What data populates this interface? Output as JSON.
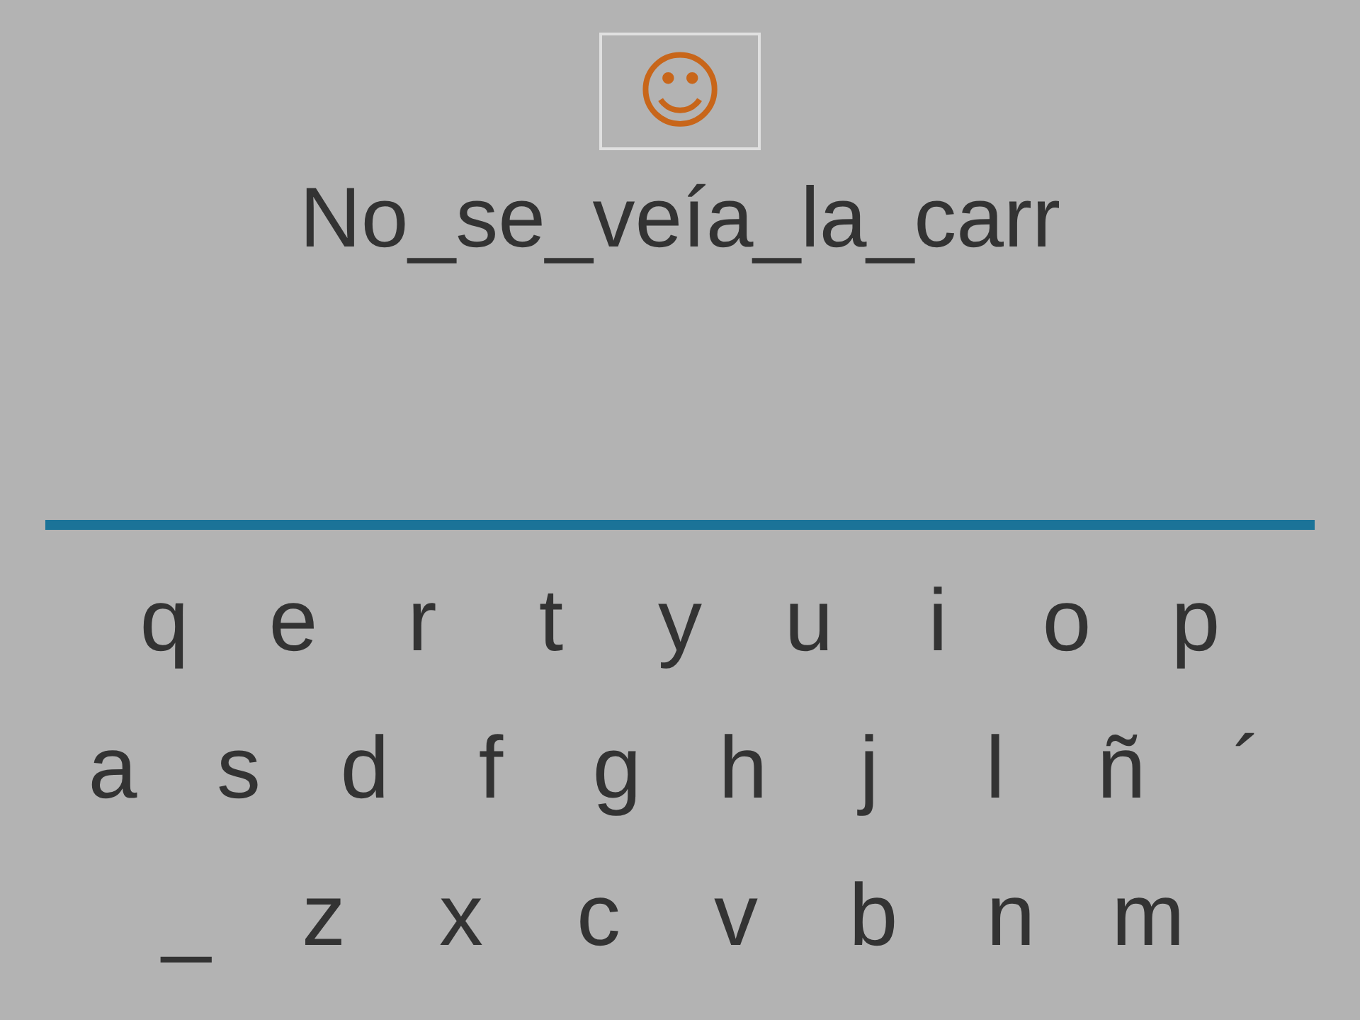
{
  "hint_box": {
    "symbol": "☺"
  },
  "phrase": "No_se_veía_la_carr",
  "keyboard": {
    "rows": [
      [
        "q",
        "e",
        "r",
        "t",
        "y",
        "u",
        "i",
        "o",
        "p"
      ],
      [
        "a",
        "s",
        "d",
        "f",
        "g",
        "h",
        "j",
        "l",
        "ñ",
        "´"
      ],
      [
        "_",
        "z",
        "x",
        "c",
        "v",
        "b",
        "n",
        "m"
      ]
    ]
  }
}
